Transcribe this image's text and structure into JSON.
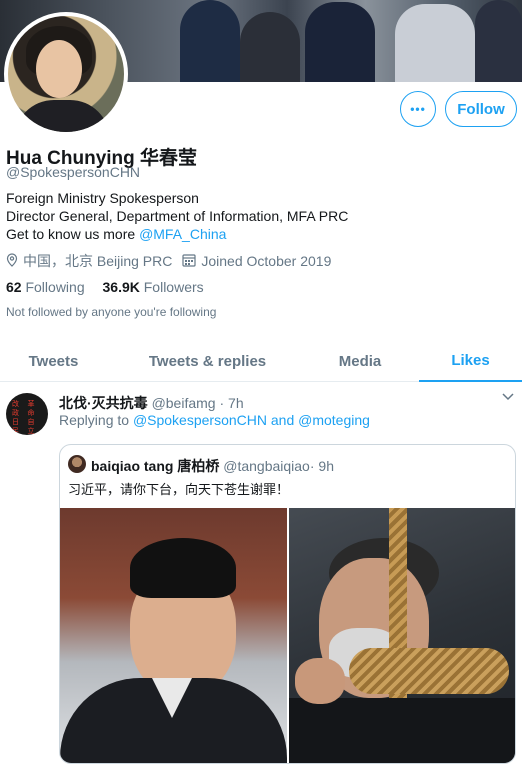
{
  "profile": {
    "name": "Hua Chunying 华春莹",
    "handle": "@SpokespersonCHN",
    "bio_line1": "Foreign Ministry Spokesperson",
    "bio_line2": "Director General, Department of Information, MFA PRC",
    "bio_line3_prefix": "Get to know us more ",
    "bio_line3_link": "@MFA_China",
    "location": "中国，北京 Beijing PRC",
    "joined": "Joined October 2019",
    "following_count": "62",
    "following_label": "Following",
    "followers_count": "36.9K",
    "followers_label": "Followers",
    "not_followed": "Not followed by anyone you're following"
  },
  "actions": {
    "more_label": "•••",
    "follow_label": "Follow"
  },
  "tabs": [
    {
      "label": "Tweets",
      "active": false
    },
    {
      "label": "Tweets & replies",
      "active": false
    },
    {
      "label": "Media",
      "active": false
    },
    {
      "label": "Likes",
      "active": true
    }
  ],
  "tweet": {
    "avatar_text": [
      "改",
      "革",
      "政",
      "命",
      "日",
      "自",
      "民",
      "立"
    ],
    "author_name": "北伐·灭共抗毒",
    "author_handle": "@beifamg",
    "time": "· 7h",
    "replying_prefix": "Replying to ",
    "replying_to": "@SpokespersonCHN and @moteging",
    "quote": {
      "author_name": "baiqiao tang 唐柏桥",
      "author_handle": "@tangbaiqiao",
      "time": "· 9h",
      "text": "习近平，请你下台，向天下苍生谢罪！"
    }
  },
  "icons": {
    "location": "location-pin-icon",
    "calendar": "calendar-icon",
    "chevron": "chevron-down-icon"
  },
  "colors": {
    "accent": "#1da1f2",
    "secondary_text": "#657786"
  }
}
